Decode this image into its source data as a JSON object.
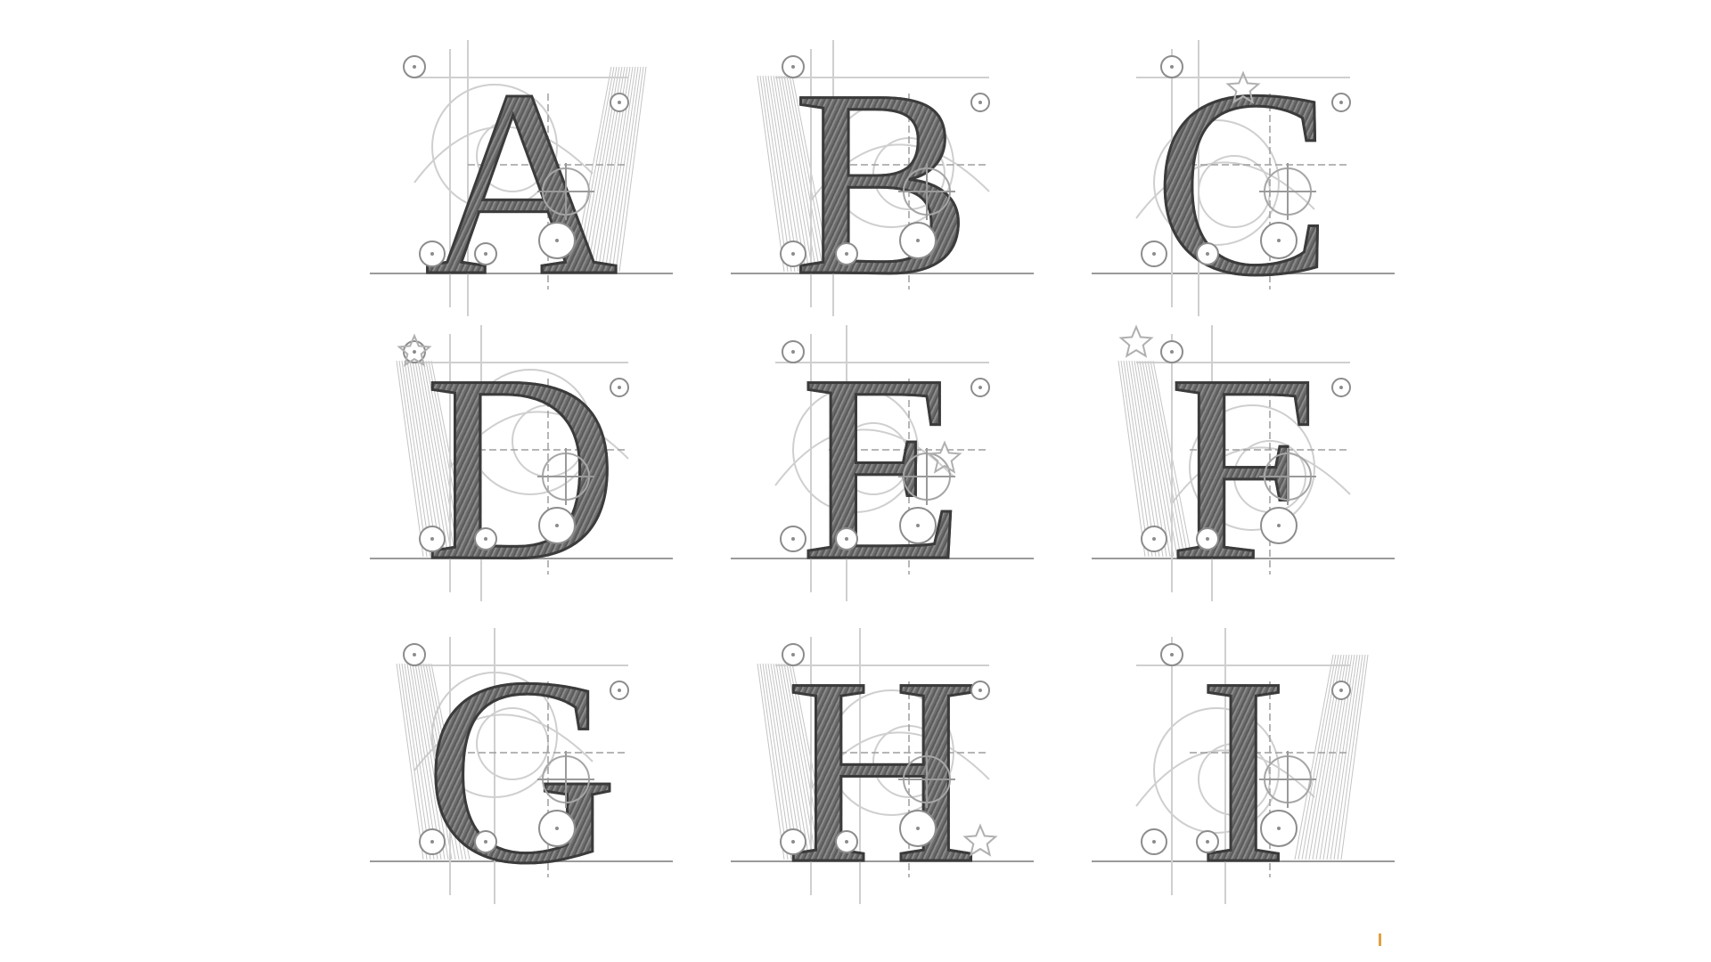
{
  "letters": [
    "A",
    "B",
    "C",
    "D",
    "E",
    "F",
    "G",
    "H",
    "I"
  ],
  "colors": {
    "background": "#ffffff",
    "letter_fill": "#6f6f6f",
    "letter_stroke": "#3b3b3b",
    "guide_lines": "#9a9a9a",
    "swirl_ornament": "#cfcfcf",
    "accent_tick": "#e0a040"
  },
  "icons": [
    "construction-circle-icon",
    "crosshair-circle-icon",
    "star-outline-icon",
    "swirl-ornament-icon",
    "fan-ray-lines-icon"
  ]
}
